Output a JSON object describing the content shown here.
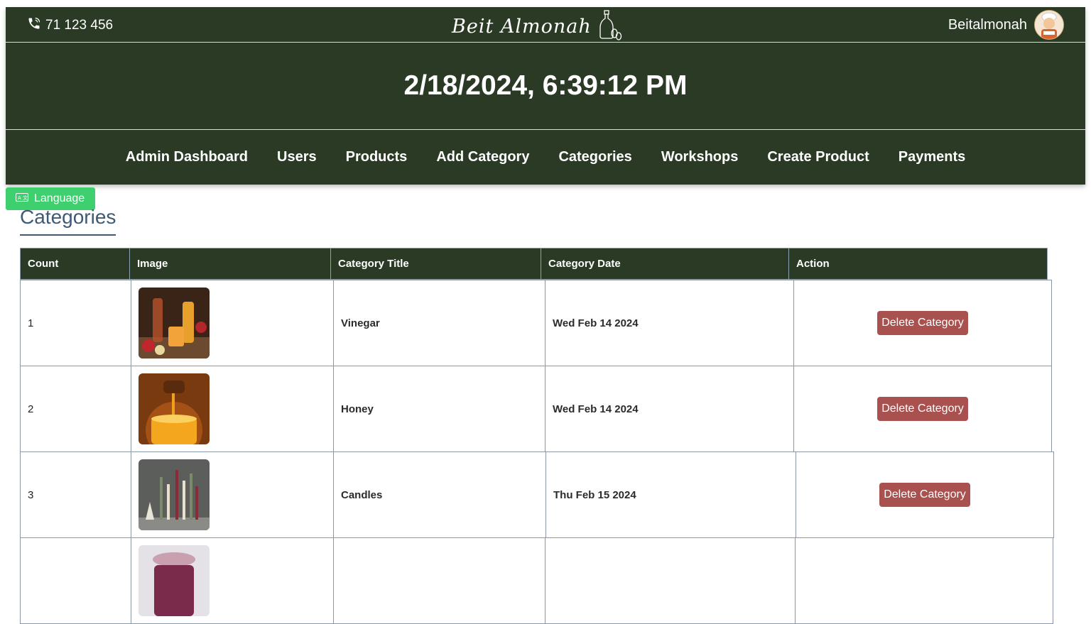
{
  "header": {
    "phone": "71 123 456",
    "brand": "Beit Almonah",
    "username": "Beitalmonah",
    "datetime": "2/18/2024, 6:39:12 PM"
  },
  "nav": [
    "Admin Dashboard",
    "Users",
    "Products",
    "Add Category",
    "Categories",
    "Workshops",
    "Create Product",
    "Payments"
  ],
  "language_button": "Language",
  "page_title": "Categories",
  "table": {
    "columns": [
      "Count",
      "Image",
      "Category Title",
      "Category Date",
      "Action"
    ],
    "rows": [
      {
        "count": "1",
        "image": "vinegar-image",
        "title": "Vinegar",
        "date": "Wed Feb 14 2024",
        "action": "Delete Category"
      },
      {
        "count": "2",
        "image": "honey-image",
        "title": "Honey",
        "date": "Wed Feb 14 2024",
        "action": "Delete Category"
      },
      {
        "count": "3",
        "image": "candles-image",
        "title": "Candles",
        "date": "Thu Feb 15 2024",
        "action": "Delete Category"
      }
    ]
  },
  "colors": {
    "header_bg": "#2b3a24",
    "language_button": "#3ecf6f",
    "delete_button": "#a8514f",
    "title_color": "#3e5a75"
  }
}
